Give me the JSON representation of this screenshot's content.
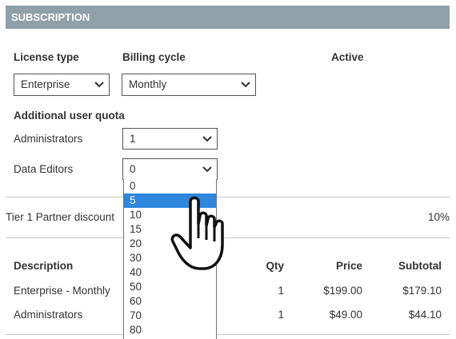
{
  "section": {
    "title": "SUBSCRIPTION"
  },
  "license": {
    "label": "License type",
    "value": "Enterprise"
  },
  "billing": {
    "label": "Billing cycle",
    "value": "Monthly"
  },
  "active": {
    "label": "Active"
  },
  "quota": {
    "label": "Additional user quota",
    "administrators": {
      "label": "Administrators",
      "value": "1"
    },
    "data_editors": {
      "label": "Data Editors",
      "value": "0"
    }
  },
  "discount": {
    "label": "Tier 1 Partner discount",
    "value": "10%"
  },
  "dropdown": {
    "options": [
      "0",
      "5",
      "10",
      "15",
      "20",
      "30",
      "40",
      "50",
      "60",
      "70",
      "80"
    ],
    "selected_index": 1
  },
  "table": {
    "headers": {
      "description": "Description",
      "qty": "Qty",
      "price": "Price",
      "subtotal": "Subtotal"
    },
    "rows": [
      {
        "description": "Enterprise - Monthly",
        "qty": "1",
        "price": "$199.00",
        "subtotal": "$179.10"
      },
      {
        "description": "Administrators",
        "qty": "1",
        "price": "$49.00",
        "subtotal": "$44.10"
      }
    ]
  },
  "icons": {
    "chevron": "chevron-down-icon",
    "cursor": "hand-pointer-icon"
  }
}
